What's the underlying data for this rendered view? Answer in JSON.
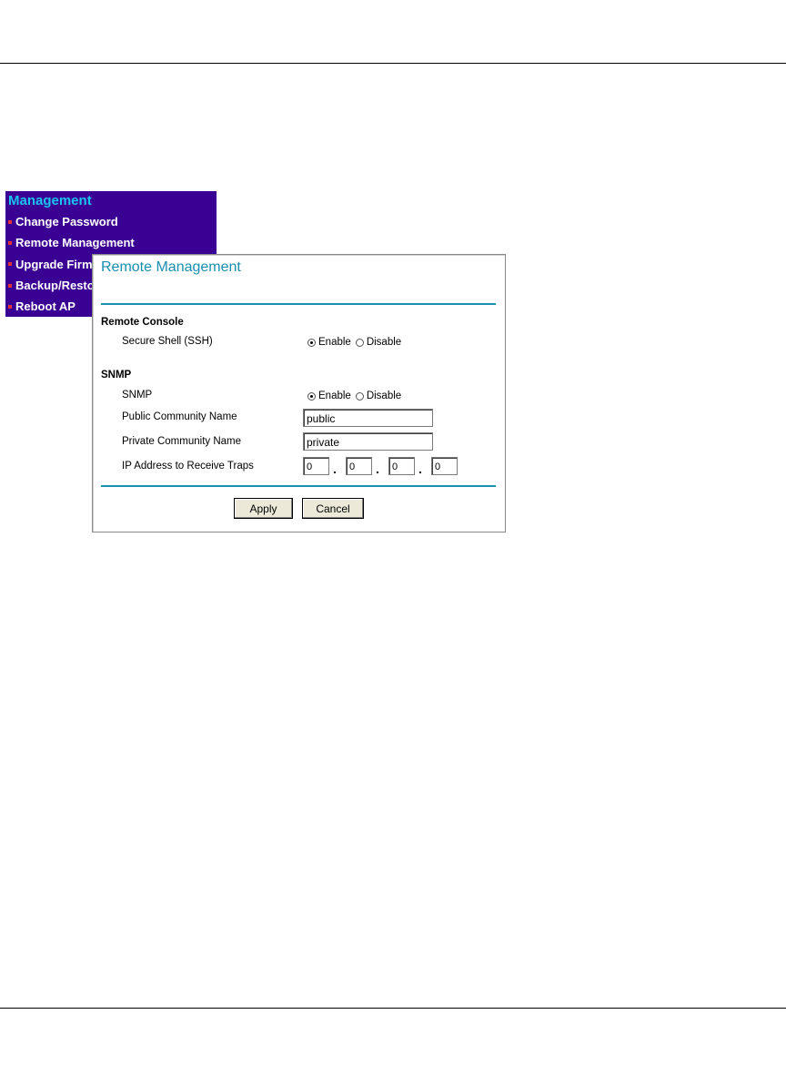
{
  "menu": {
    "title": "Management",
    "items": [
      {
        "label": "Change Password"
      },
      {
        "label": "Remote Management"
      },
      {
        "label": "Upgrade Firm"
      },
      {
        "label": "Backup/Resto"
      },
      {
        "label": "Reboot AP"
      }
    ]
  },
  "panel": {
    "title": "Remote Management",
    "remote_console": {
      "heading": "Remote Console",
      "ssh_label": "Secure Shell (SSH)",
      "enable_label": "Enable",
      "disable_label": "Disable",
      "selected": "Enable"
    },
    "snmp": {
      "heading": "SNMP",
      "snmp_label": "SNMP",
      "enable_label": "Enable",
      "disable_label": "Disable",
      "selected": "Enable",
      "public_label": "Public Community Name",
      "public_value": "public",
      "private_label": "Private Community Name",
      "private_value": "private",
      "trap_label": "IP Address to Receive Traps",
      "trap_ip": [
        "0",
        "0",
        "0",
        "0"
      ],
      "ip_separator": "."
    },
    "buttons": {
      "apply": "Apply",
      "cancel": "Cancel"
    }
  },
  "colors": {
    "menu_bg": "#3a0093",
    "menu_title": "#19c4f0",
    "bullet": "#e0303a",
    "accent": "#1a8fb0"
  }
}
